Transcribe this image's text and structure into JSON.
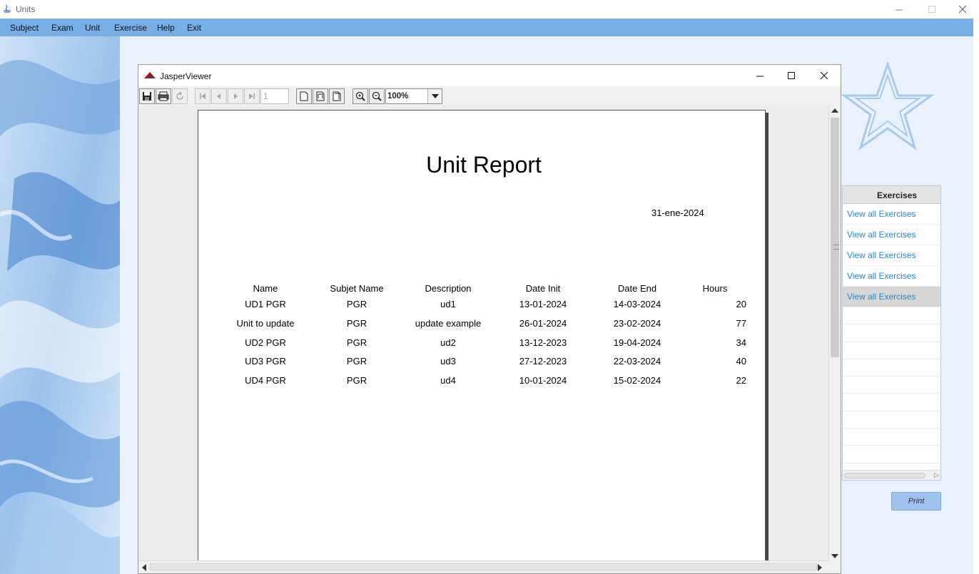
{
  "window": {
    "title": "Units"
  },
  "menubar": {
    "items": [
      "Subject",
      "Exam",
      "Unit",
      "Exercise",
      "Help",
      "Exit"
    ]
  },
  "exercises": {
    "header": "Exercises",
    "links": [
      "View all Exercises",
      "View all Exercises",
      "View all Exercises",
      "View all Exercises",
      "View all Exercises"
    ],
    "selected_row": 4
  },
  "print_button": {
    "label": "Print"
  },
  "viewer": {
    "title": "JasperViewer",
    "page_number": "1",
    "zoom": "100%"
  },
  "report": {
    "title": "Unit Report",
    "date": "31-ene-2024",
    "columns": [
      "Name",
      "Subjet Name",
      "Description",
      "Date Init",
      "Date End",
      "Hours"
    ],
    "rows": [
      [
        "UD1 PGR",
        "PGR",
        "ud1",
        "13-01-2024",
        "14-03-2024",
        "20"
      ],
      [
        "Unit to update",
        "PGR",
        "update example",
        "26-01-2024",
        "23-02-2024",
        "77"
      ],
      [
        "UD2 PGR",
        "PGR",
        "ud2",
        "13-12-2023",
        "19-04-2024",
        "34"
      ],
      [
        "UD3 PGR",
        "PGR",
        "ud3",
        "27-12-2023",
        "22-03-2024",
        "40"
      ],
      [
        "UD4 PGR",
        "PGR",
        "ud4",
        "10-01-2024",
        "15-02-2024",
        "22"
      ]
    ]
  },
  "colors": {
    "menubar": "#78aee6",
    "client": "#e9f1fb",
    "link": "#1c8ad6",
    "print_button": "#9ec3ef"
  }
}
